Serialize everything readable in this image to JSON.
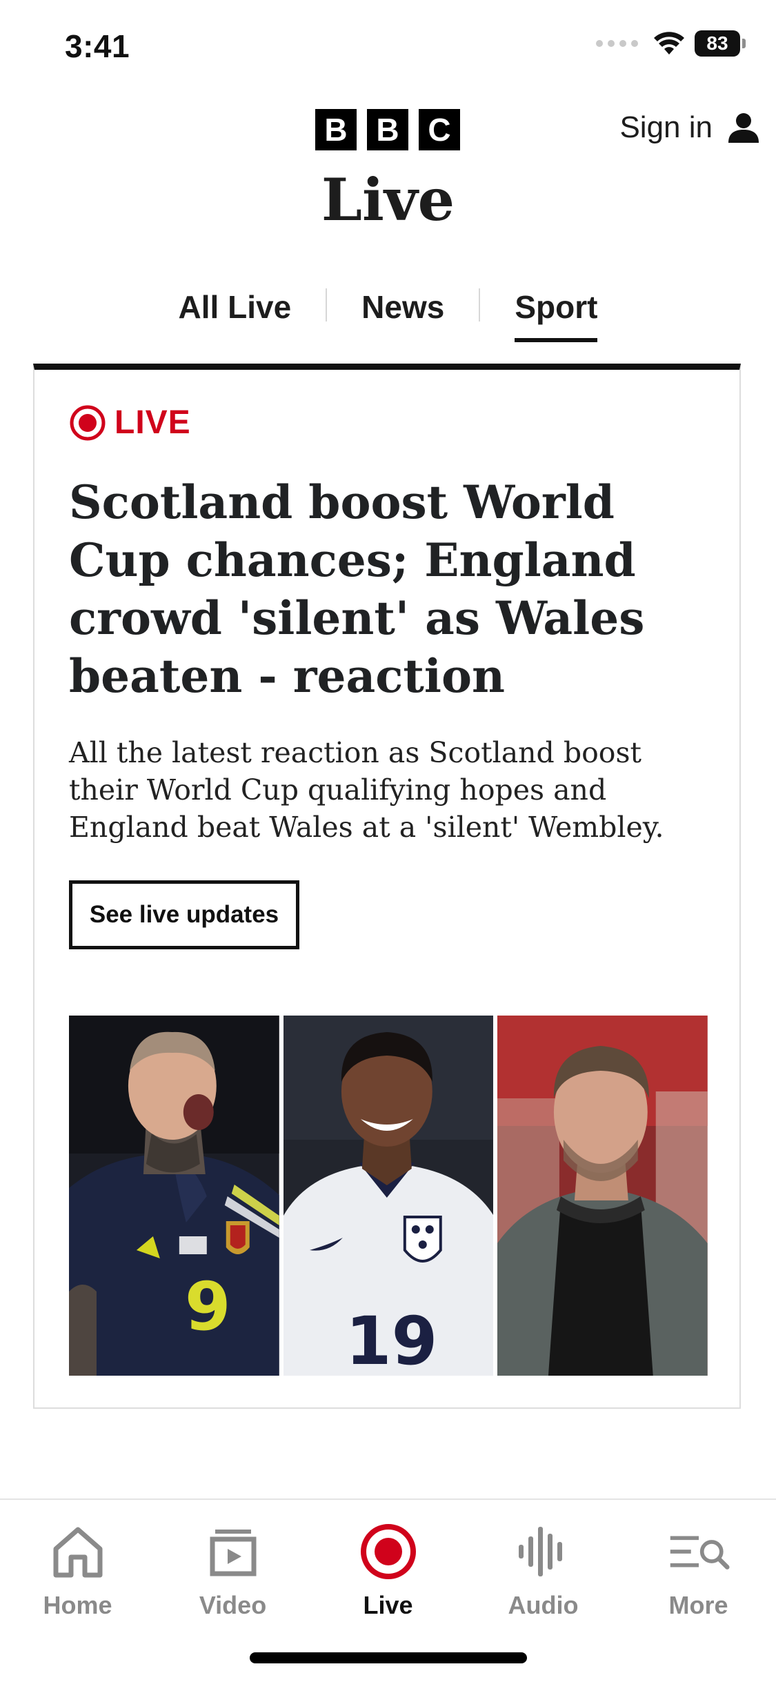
{
  "status_bar": {
    "time": "3:41",
    "battery": "83"
  },
  "header": {
    "logo_letters": [
      "B",
      "B",
      "C"
    ],
    "title": "Live",
    "sign_in_label": "Sign in",
    "user_icon": "person-icon"
  },
  "tabs": [
    {
      "label": "All Live",
      "active": false
    },
    {
      "label": "News",
      "active": false
    },
    {
      "label": "Sport",
      "active": true
    }
  ],
  "card": {
    "live_label": "LIVE",
    "live_icon": "live-record-icon",
    "headline": "Scotland boost World Cup chances; England crowd 'silent' as Wales beaten - reaction",
    "summary": "All the latest reaction as Scotland boost their World Cup qualifying hopes and England beat Wales at a 'silent' Wembley.",
    "button_label": "See live updates",
    "photo_texts": {
      "shirt_number_left": "9",
      "shirt_number_middle": "19"
    }
  },
  "bottom_nav": [
    {
      "label": "Home",
      "icon": "home-icon",
      "active": false
    },
    {
      "label": "Video",
      "icon": "video-icon",
      "active": false
    },
    {
      "label": "Live",
      "icon": "live-icon",
      "active": true
    },
    {
      "label": "Audio",
      "icon": "audio-icon",
      "active": false
    },
    {
      "label": "More",
      "icon": "more-search-icon",
      "active": false
    }
  ],
  "colors": {
    "live_red": "#d0021b",
    "text": "#202224",
    "inactive_nav": "#8a8a8a"
  }
}
